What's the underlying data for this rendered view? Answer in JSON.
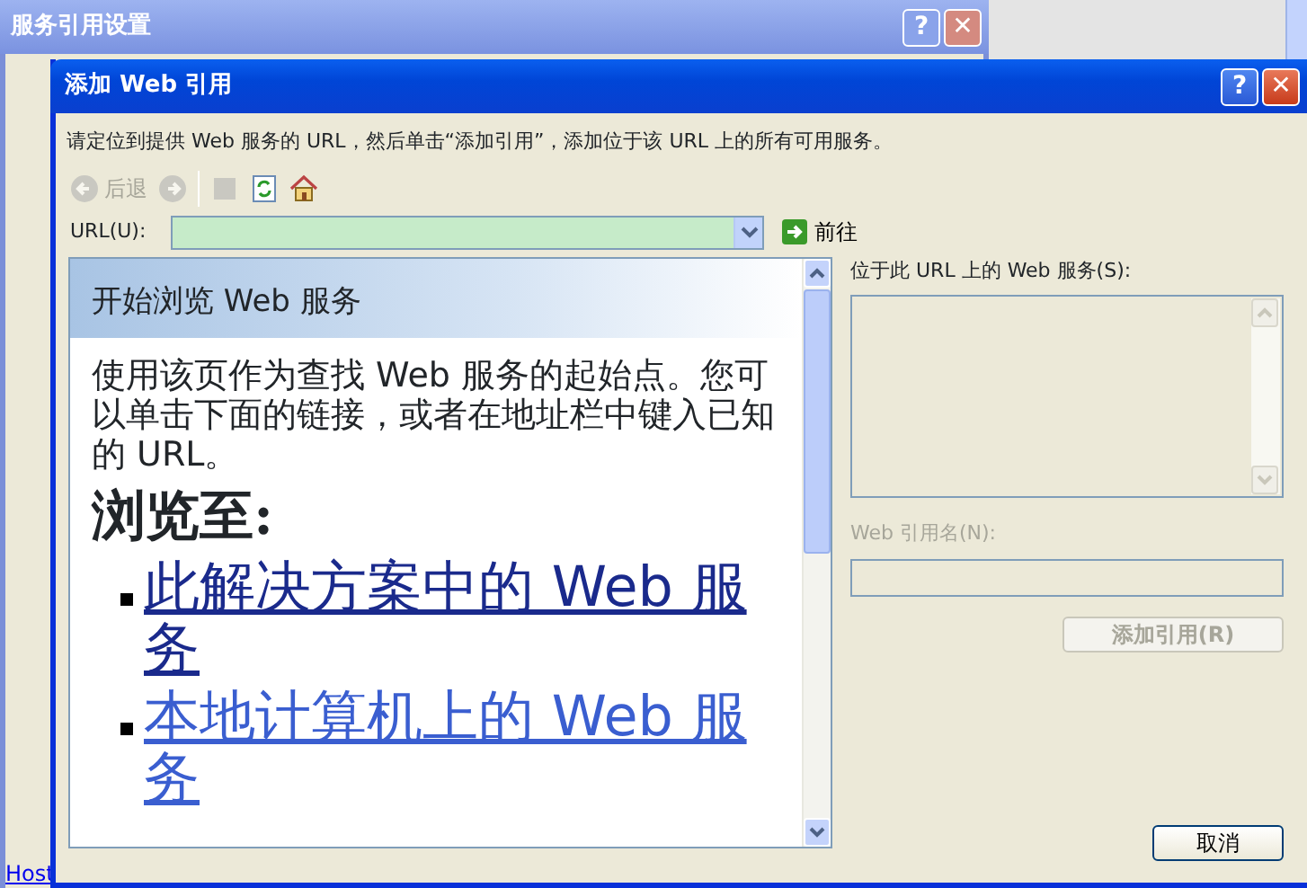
{
  "back_window": {
    "title": "服务引用设置",
    "title_buttons": [
      "?",
      "✕"
    ],
    "link": "Host"
  },
  "dialog": {
    "title": "添加 Web 引用",
    "title_buttons": [
      "?",
      "✕"
    ],
    "instruction": "请定位到提供 Web 服务的 URL，然后单击“添加引用”，添加位于该 URL 上的所有可用服务。",
    "toolbar": [
      {
        "kind": "back",
        "label": "后退",
        "disabled": true
      },
      {
        "kind": "forward",
        "disabled": true
      },
      {
        "kind": "separator"
      },
      {
        "kind": "stop",
        "disabled": true
      },
      {
        "kind": "refresh",
        "disabled": false
      },
      {
        "kind": "home",
        "disabled": false
      }
    ],
    "url": {
      "label": "URL(U):"
    },
    "go_button": {
      "label": "前往"
    },
    "browser": {
      "heading": "开始浏览 Web 服务",
      "paragraph": "使用该页作为查找 Web 服务的起始点。您可以单击下面的链接，或者在地址栏中键入已知的 URL。",
      "browse_heading": "浏览至:",
      "links": [
        {
          "text": "此解决方案中的 Web 服务",
          "visited": true
        },
        {
          "text": "本地计算机上的 Web 服务",
          "visited": false
        }
      ]
    },
    "services": {
      "label": "位于此 URL 上的 Web 服务(S):"
    },
    "ref_name": {
      "label": "Web 引用名(N):",
      "disabled": true
    },
    "add_button": {
      "label": "添加引用(R)",
      "disabled": true
    },
    "cancel_button": {
      "label": "取消"
    }
  }
}
